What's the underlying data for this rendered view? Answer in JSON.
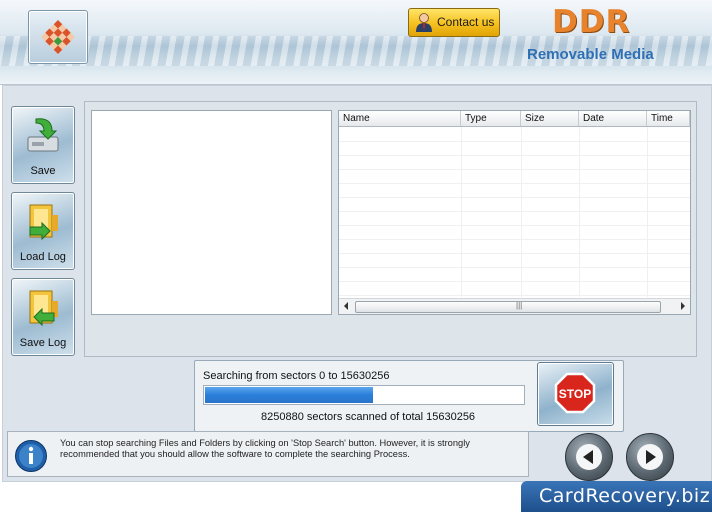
{
  "header": {
    "contact_label": "Contact us",
    "brand": "DDR",
    "subtitle": "Removable Media"
  },
  "sidebar": {
    "items": [
      {
        "label": "Save",
        "icon": "save-disk-icon"
      },
      {
        "label": "Load Log",
        "icon": "load-log-icon"
      },
      {
        "label": "Save Log",
        "icon": "save-log-icon"
      }
    ]
  },
  "file_list": {
    "columns": [
      "Name",
      "Type",
      "Size",
      "Date",
      "Time"
    ],
    "rows": []
  },
  "progress": {
    "range_text": "Searching from sectors 0 to 15630256",
    "scanned_text": "8250880  sectors scanned of total 15630256",
    "fraction": 0.528
  },
  "stop_button": {
    "label": "STOP",
    "icon": "stop-sign-icon"
  },
  "info": {
    "icon": "info-icon",
    "text": "You can stop searching Files and Folders by clicking on 'Stop Search' button. However, it is strongly recommended that you should allow the software to complete the searching Process."
  },
  "nav": {
    "back_icon": "back-arrow-icon",
    "next_icon": "next-arrow-icon"
  },
  "footer": {
    "badge": "CardRecovery.biz"
  },
  "colors": {
    "brand": "#e8832d",
    "subtitle": "#2f6fb4",
    "progress": "#2a7fd9",
    "footer": "#1e4f8c"
  }
}
